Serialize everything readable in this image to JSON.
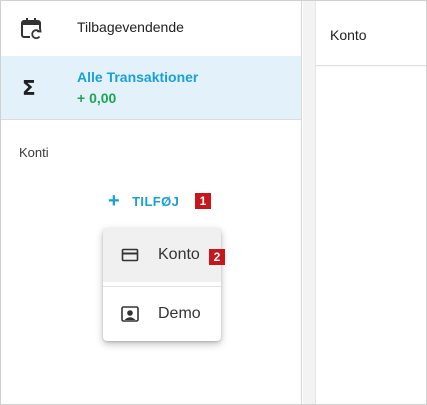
{
  "sidebar": {
    "recurring": {
      "label": "Tilbagevendende",
      "icon": "calendar-refresh-icon"
    },
    "all_transactions": {
      "label": "Alle Transaktioner",
      "amount": "+ 0,00",
      "icon": "sigma-icon"
    },
    "accounts_section_title": "Konti",
    "add_button": {
      "icon": "plus-icon",
      "label": "TILFØJ",
      "badge": "1"
    }
  },
  "add_menu": {
    "items": [
      {
        "label": "Konto",
        "icon": "card-icon",
        "badge": "2"
      },
      {
        "label": "Demo",
        "icon": "account-box-icon"
      }
    ]
  },
  "main": {
    "header": {
      "column_title": "Konto"
    }
  },
  "colors": {
    "accent": "#1aa0d8",
    "positive": "#1ea456",
    "selected_bg": "#e3f2fa",
    "badge": "#c8161d"
  }
}
